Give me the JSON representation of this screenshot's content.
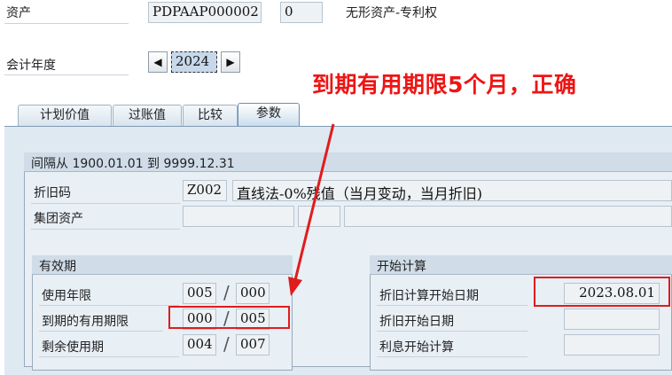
{
  "header": {
    "asset_label": "资产",
    "asset_value": "PDPAAP000002",
    "sub_number": "0",
    "asset_description": "无形资产-专利权",
    "fiscal_year_label": "会计年度",
    "fiscal_year_value": "2024",
    "prev_icon": "◀",
    "next_icon": "▶"
  },
  "annotation": {
    "text": "到期有用期限5个月，正确",
    "color": "#ee1515"
  },
  "tabs": [
    {
      "label": "计划价值"
    },
    {
      "label": "过账值"
    },
    {
      "label": "比较"
    },
    {
      "label": "参数"
    }
  ],
  "interval": {
    "text": "间隔从 1900.01.01 到 9999.12.31",
    "depreciation_key_label": "折旧码",
    "depreciation_key_value": "Z002",
    "depreciation_key_desc": "直线法-0%残值（当月变动，当月折旧)",
    "group_asset_label": "集团资产"
  },
  "useful_life": {
    "title": "有效期",
    "rows": [
      {
        "label": "使用年限",
        "years": "005",
        "periods": "000"
      },
      {
        "label": "到期的有用期限",
        "years": "000",
        "periods": "005"
      },
      {
        "label": "剩余使用期",
        "years": "004",
        "periods": "007"
      }
    ],
    "separator": "/"
  },
  "start_calc": {
    "title": "开始计算",
    "rows": [
      {
        "label": "折旧计算开始日期",
        "value": "2023.08.01"
      },
      {
        "label": "折旧开始日期",
        "value": ""
      },
      {
        "label": "利息开始计算",
        "value": ""
      }
    ]
  }
}
